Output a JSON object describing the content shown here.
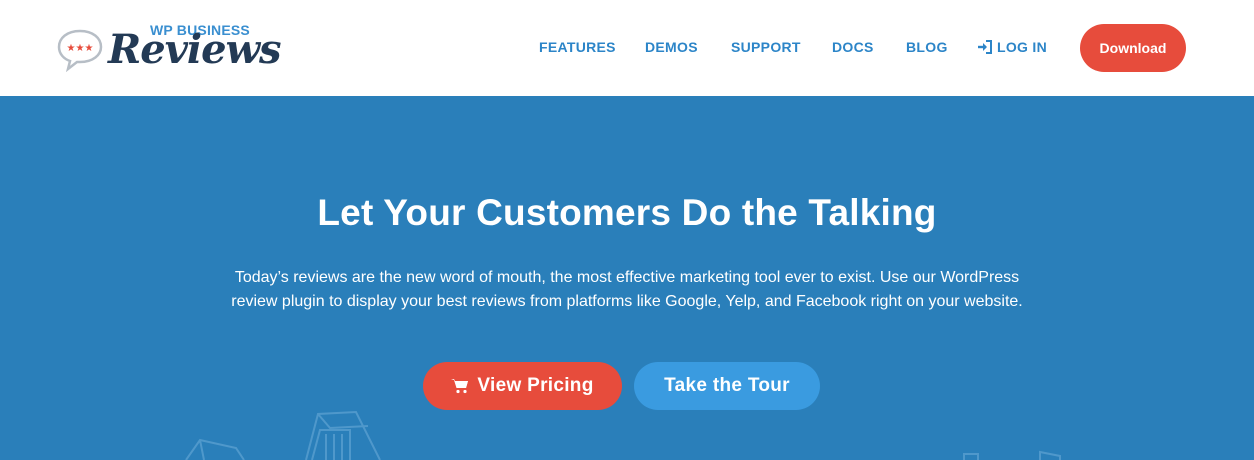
{
  "header": {
    "logo": {
      "small_text": "WP BUSINESS",
      "big_text": "Reviews"
    },
    "nav": [
      {
        "label": "FEATURES"
      },
      {
        "label": "DEMOS"
      },
      {
        "label": "SUPPORT"
      },
      {
        "label": "DOCS"
      },
      {
        "label": "BLOG"
      },
      {
        "label": "LOG IN",
        "icon": "sign-in-icon"
      }
    ],
    "download_label": "Download"
  },
  "hero": {
    "title": "Let Your Customers Do the Talking",
    "text": "Today’s reviews are the new word of mouth, the most effective marketing tool ever to exist. Use our WordPress review plugin to display your best reviews from platforms like Google, Yelp, and Facebook right on your website.",
    "primary_button": {
      "label": "View Pricing",
      "icon": "shopping-cart-icon"
    },
    "secondary_button": {
      "label": "Take the Tour"
    }
  },
  "colors": {
    "hero_bg": "#2a7fba",
    "nav_text": "#2c85c8",
    "accent_red": "#e74c3c",
    "accent_blue": "#3a9be0",
    "logo_dark": "#233a55"
  }
}
